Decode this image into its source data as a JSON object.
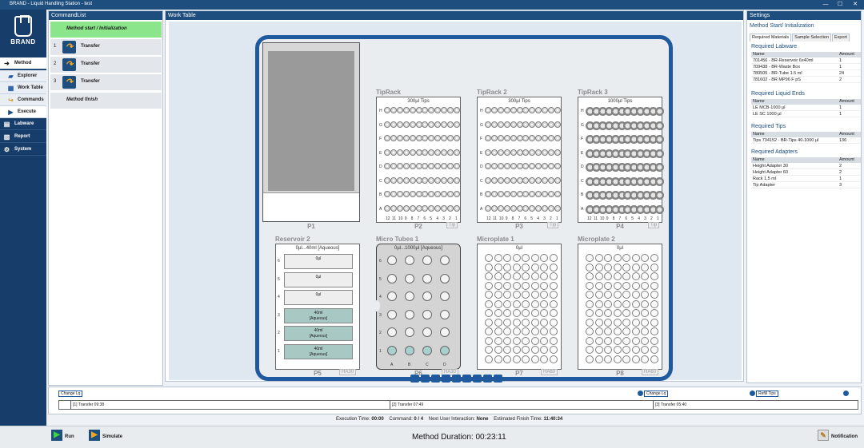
{
  "window": {
    "title": "BRAND - Liquid Handling Station - test",
    "controls": [
      "—",
      "☐",
      "✕"
    ]
  },
  "brand": {
    "name": "BRAND"
  },
  "nav": {
    "method": "Method",
    "explorer": "Explorer",
    "worktable": "Work Table",
    "commands": "Commands",
    "execute": "Execute",
    "labware": "Labware",
    "report": "Report",
    "system": "System"
  },
  "commandlist": {
    "title": "CommandList",
    "start": "Method start / Initialization",
    "items": [
      {
        "num": "1",
        "label": "Transfer"
      },
      {
        "num": "2",
        "label": "Transfer"
      },
      {
        "num": "3",
        "label": "Transfer"
      }
    ],
    "finish": "Method finish"
  },
  "worktable": {
    "title": "Work Table",
    "positions": {
      "p1": {
        "name": "P1"
      },
      "p2": {
        "name": "P2",
        "title": "TipRack",
        "caption": "300µl Tips",
        "tag": "Tip"
      },
      "p3": {
        "name": "P3",
        "title": "TipRack 2",
        "caption": "300µl Tips",
        "tag": "Tip"
      },
      "p4": {
        "name": "P4",
        "title": "TipRack 3",
        "caption": "1000µl Tips",
        "tag": "Tip"
      },
      "p5": {
        "name": "P5",
        "title": "Reservoir 2",
        "caption": "0µl...40ml [Aqueous]",
        "tag": "HA30"
      },
      "p6": {
        "name": "P6",
        "title": "Micro Tubes 1",
        "caption": "0µl...1000µl [Aqueous]",
        "tag": "HA30"
      },
      "p7": {
        "name": "P7",
        "title": "Microplate 1",
        "caption": "0µl",
        "tag": "HA60"
      },
      "p8": {
        "name": "P8",
        "title": "Microplate 2",
        "caption": "0µl",
        "tag": "HA60"
      }
    },
    "reservoir_cells": [
      {
        "label": "0µl",
        "sub": "",
        "filled": false
      },
      {
        "label": "0µl",
        "sub": "",
        "filled": false
      },
      {
        "label": "0µl",
        "sub": "",
        "filled": false
      },
      {
        "label": "40ml",
        "sub": "[Aqueous]",
        "filled": true
      },
      {
        "label": "40ml",
        "sub": "[Aqueous]",
        "filled": true
      },
      {
        "label": "40ml",
        "sub": "[Aqueous]",
        "filled": true
      }
    ],
    "tool_icons": [
      "zoom-in-icon",
      "zoom-out-icon",
      "zoom-fit-icon",
      "zoom-select-icon",
      "home-icon",
      "labware-icon",
      "info-icon",
      "table-icon",
      "print-icon"
    ]
  },
  "settings": {
    "title": "Settings",
    "heading": "Method Start/ Initialization",
    "tabs": [
      "Required Materials",
      "Sample Selection",
      "Export"
    ],
    "labware": {
      "title": "Required Labware",
      "cols": [
        "Name",
        "Amount"
      ],
      "rows": [
        [
          "701456 - BR-Reservoir 6x40ml",
          "1"
        ],
        [
          "709438 - BR-Waste Box",
          "1"
        ],
        [
          "780505 - BR-Tube 1.5 ml",
          "24"
        ],
        [
          "781602 - BR MP96 F pS",
          "2"
        ]
      ]
    },
    "liquid_ends": {
      "title": "Required Liquid Ends",
      "cols": [
        "Name",
        "Amount"
      ],
      "rows": [
        [
          "LE MCB-1000 µl",
          "1"
        ],
        [
          "LE SC 1000 µl",
          "1"
        ]
      ]
    },
    "tips": {
      "title": "Required Tips",
      "cols": [
        "Name",
        "Amount"
      ],
      "rows": [
        [
          "Tips 734152 - BR-Tips 40-1000 µl",
          "136"
        ]
      ]
    },
    "adapters": {
      "title": "Required Adapters",
      "cols": [
        "Name",
        "Amount"
      ],
      "rows": [
        [
          "Height Adapter 30",
          "2"
        ],
        [
          "Height Adapter 60",
          "2"
        ],
        [
          "Rack 1,5 ml",
          "1"
        ],
        [
          "Tip Adapter",
          "3"
        ]
      ]
    }
  },
  "timeline": {
    "segments": [
      "[1] Transfer 09:38",
      "[2] Transfer 07:49",
      "[3] Transfer 05:40"
    ],
    "markers": {
      "change_lq_1": "Change Lq",
      "change_lq_2": "Change Lq",
      "refill_tips": "Refill Tips"
    }
  },
  "status": {
    "exec_label": "Execution Time:",
    "exec_value": "00:00",
    "cmd_label": "Command:",
    "cmd_value": "0 / 4",
    "next_label": "Next User Interaction:",
    "next_value": "None",
    "finish_label": "Estimated Finish Time:",
    "finish_value": "11:40:34"
  },
  "bottom": {
    "run": "Run",
    "simulate": "Simulate",
    "duration_label": "Method Duration:",
    "duration_value": "00:23:11",
    "notification": "Notification"
  },
  "colors": {
    "navy": "#173d6a",
    "deck_border": "#1f5a9f",
    "start_green": "#8be68b",
    "aqueous": "#a8c8c4"
  }
}
